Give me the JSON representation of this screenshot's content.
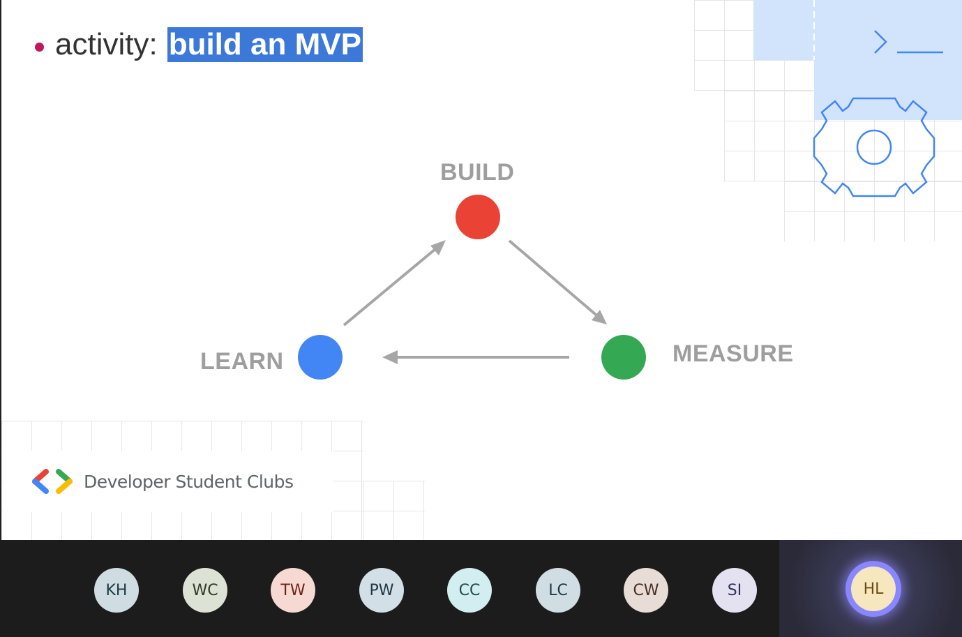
{
  "slide": {
    "bullet": {
      "label": "activity:",
      "highlight": "build an MVP"
    },
    "cycle": {
      "build": {
        "label": "BUILD",
        "color": "#ea4335"
      },
      "measure": {
        "label": "MEASURE",
        "color": "#34a853"
      },
      "learn": {
        "label": "LEARN",
        "color": "#4285f4"
      }
    },
    "logo": {
      "text": "Developer Student Clubs"
    },
    "decor": {
      "terminal_icon": "terminal-prompt-icon",
      "gear_icon": "gear-icon"
    }
  },
  "participants": [
    {
      "initials": "KH",
      "bg": "#cfdde3",
      "fg": "#1e3a44"
    },
    {
      "initials": "WC",
      "bg": "#dde3d4",
      "fg": "#2f3b22"
    },
    {
      "initials": "TW",
      "bg": "#f6d9d2",
      "fg": "#6b2418"
    },
    {
      "initials": "PW",
      "bg": "#d2dfe6",
      "fg": "#1f3644"
    },
    {
      "initials": "CC",
      "bg": "#d3eef0",
      "fg": "#1d4a4f"
    },
    {
      "initials": "LC",
      "bg": "#d0dde3",
      "fg": "#1e3a44"
    },
    {
      "initials": "CW",
      "bg": "#e8dcd6",
      "fg": "#4a2e22"
    },
    {
      "initials": "SI",
      "bg": "#e4e1f1",
      "fg": "#33305a"
    }
  ],
  "active_speaker": {
    "initials": "HL",
    "bg": "#f6e7bf",
    "fg": "#6a4b12",
    "ring": "#8a86ff"
  }
}
